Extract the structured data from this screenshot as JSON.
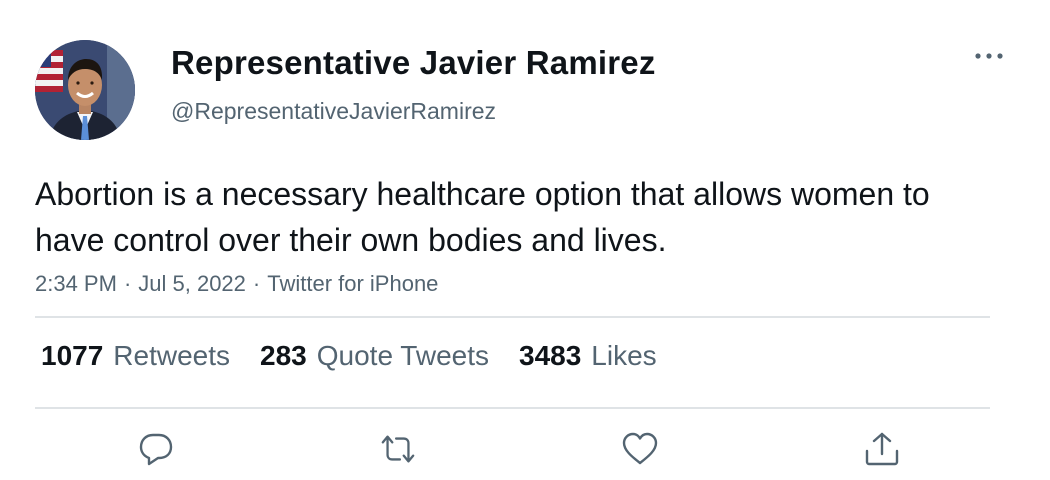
{
  "author": {
    "display_name": "Representative Javier Ramirez",
    "handle": "@RepresentativeJavierRamirez",
    "avatar_icon": "profile-photo"
  },
  "tweet": {
    "text": "Abortion is a necessary healthcare option that allows women to have control over their own bodies and lives.",
    "time": "2:34 PM",
    "date": "Jul 5, 2022",
    "source": "Twitter for iPhone",
    "separator": "·"
  },
  "stats": {
    "retweets": {
      "count": "1077",
      "label": "Retweets"
    },
    "quote_tweets": {
      "count": "283",
      "label": "Quote Tweets"
    },
    "likes": {
      "count": "3483",
      "label": "Likes"
    }
  },
  "actions": {
    "reply_icon": "reply-icon",
    "retweet_icon": "retweet-icon",
    "like_icon": "heart-icon",
    "share_icon": "share-icon",
    "more_icon": "more-horizontal-icon"
  },
  "colors": {
    "text_primary": "#0f1419",
    "text_secondary": "#536471",
    "divider": "#dfe3e6",
    "icon": "#536471"
  }
}
